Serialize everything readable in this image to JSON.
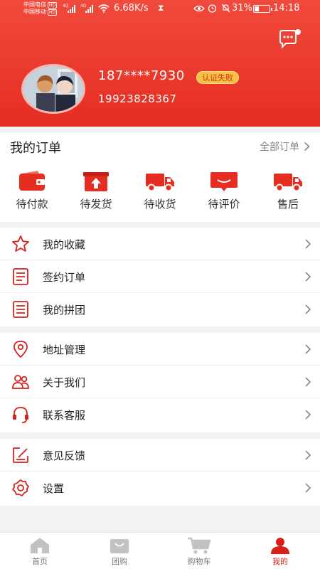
{
  "status_bar": {
    "carrier1": "中国电信",
    "carrier2": "中国移动",
    "hd": "HD",
    "network_type": "4G",
    "net_speed": "6.68K/s",
    "battery_pct": "31%",
    "time": "14:18",
    "battery_level": 0.31
  },
  "profile": {
    "phone_masked": "187****7930",
    "auth_status": "认证失败",
    "phone_full": "19923828367"
  },
  "orders": {
    "title": "我的订单",
    "all_label": "全部订单",
    "items": [
      {
        "label": "待付款",
        "icon": "wallet-icon"
      },
      {
        "label": "待发货",
        "icon": "box-upload-icon"
      },
      {
        "label": "待收货",
        "icon": "truck-icon"
      },
      {
        "label": "待评价",
        "icon": "review-icon"
      },
      {
        "label": "售后",
        "icon": "truck-aftersale-icon"
      }
    ]
  },
  "menu": {
    "group1": [
      {
        "label": "我的收藏",
        "icon": "star-icon"
      },
      {
        "label": "签约订单",
        "icon": "document-icon"
      },
      {
        "label": "我的拼团",
        "icon": "document-list-icon"
      }
    ],
    "group2": [
      {
        "label": "地址管理",
        "icon": "location-pin-icon"
      },
      {
        "label": "关于我们",
        "icon": "people-icon"
      },
      {
        "label": "联系客服",
        "icon": "headset-icon"
      }
    ],
    "group3": [
      {
        "label": "意见反馈",
        "icon": "feedback-edit-icon"
      },
      {
        "label": "设置",
        "icon": "settings-gear-icon"
      }
    ]
  },
  "tabbar": {
    "tabs": [
      {
        "label": "首页",
        "icon": "home-icon"
      },
      {
        "label": "团购",
        "icon": "shopping-bag-icon"
      },
      {
        "label": "购物车",
        "icon": "cart-icon"
      },
      {
        "label": "我的",
        "icon": "person-icon"
      }
    ],
    "active_index": 3
  },
  "colors": {
    "brand_red": "#e62d22",
    "accent_yellow": "#f6c243",
    "icon_red": "#d8201a"
  }
}
